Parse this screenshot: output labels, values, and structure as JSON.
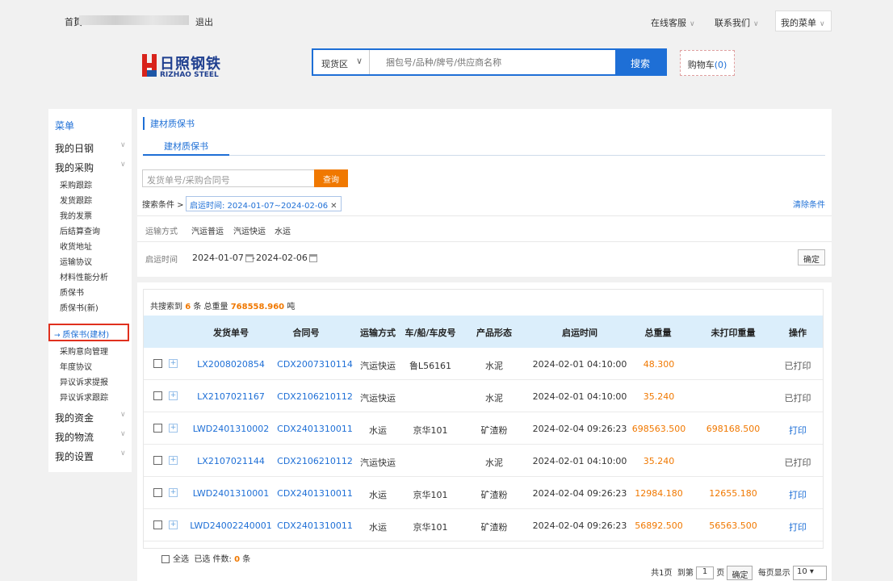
{
  "topbar": {
    "home": "首页",
    "separator": "|",
    "logout": "退出",
    "online_service": "在线客服",
    "contact_us": "联系我们",
    "my_menu": "我的菜单",
    "chevron": "∨"
  },
  "header": {
    "logo_cn": "日照钢铁",
    "logo_en": "RIZHAO STEEL",
    "search_scope": "现货区",
    "search_placeholder": "捆包号/品种/牌号/供应商名称",
    "search_button": "搜索",
    "cart_label": "购物车",
    "cart_count": "(0)"
  },
  "sidebar": {
    "title": "菜单",
    "groups": [
      {
        "label": "我的日钢"
      },
      {
        "label": "我的采购"
      },
      {
        "label": "我的资金"
      },
      {
        "label": "我的物流"
      },
      {
        "label": "我的设置"
      }
    ],
    "items": [
      {
        "label": "采购跟踪"
      },
      {
        "label": "发货跟踪"
      },
      {
        "label": "我的发票"
      },
      {
        "label": "后结算查询"
      },
      {
        "label": "收货地址"
      },
      {
        "label": "运输协议"
      },
      {
        "label": "材料性能分析"
      },
      {
        "label": "质保书"
      },
      {
        "label": "质保书(新)"
      },
      {
        "label": "质保书(建材)"
      },
      {
        "label": "采购意向管理"
      },
      {
        "label": "年度协议"
      },
      {
        "label": "异议诉求提报"
      },
      {
        "label": "异议诉求跟踪"
      }
    ]
  },
  "filter": {
    "page_title": "建材质保书",
    "tab": "建材质保书",
    "input_placeholder": "发货单号/采购合同号",
    "query_button": "查询",
    "conditions_label": "搜索条件 >",
    "condition_chip": "启运时间: 2024-01-07~2024-02-06",
    "chip_close": "✕",
    "clear": "清除条件",
    "transport_label": "运输方式",
    "transport_options": [
      "汽运普运",
      "汽运快运",
      "水运"
    ],
    "date_label": "启运时间",
    "date_from": "2024-01-07",
    "date_sep": "-",
    "date_to": "2024-02-06",
    "confirm": "确定"
  },
  "results": {
    "summary_prefix": "共搜索到",
    "count": "6",
    "summary_mid": "条 总重量",
    "total_weight": "768558.960",
    "summary_unit": "吨",
    "columns": [
      "发货单号",
      "合同号",
      "运输方式",
      "车/船/车皮号",
      "产品形态",
      "启运时间",
      "总重量",
      "未打印重量",
      "操作"
    ],
    "rows": [
      {
        "ship_no": "LX2008020854",
        "contract": "CDX2007310114",
        "transport": "汽运快运",
        "vehicle": "鲁L56161",
        "form": "水泥",
        "time": "2024-02-01 04:10:00",
        "weight": "48.300",
        "unprinted": "",
        "action": "已打印"
      },
      {
        "ship_no": "LX2107021167",
        "contract": "CDX2106210112",
        "transport": "汽运快运",
        "vehicle": "",
        "form": "水泥",
        "time": "2024-02-01 04:10:00",
        "weight": "35.240",
        "unprinted": "",
        "action": "已打印"
      },
      {
        "ship_no": "LWD2401310002",
        "contract": "CDX2401310011",
        "transport": "水运",
        "vehicle": "京华101",
        "form": "矿渣粉",
        "time": "2024-02-04 09:26:23",
        "weight": "698563.500",
        "unprinted": "698168.500",
        "action": "打印"
      },
      {
        "ship_no": "LX2107021144",
        "contract": "CDX2106210112",
        "transport": "汽运快运",
        "vehicle": "",
        "form": "水泥",
        "time": "2024-02-01 04:10:00",
        "weight": "35.240",
        "unprinted": "",
        "action": "已打印"
      },
      {
        "ship_no": "LWD2401310001",
        "contract": "CDX2401310011",
        "transport": "水运",
        "vehicle": "京华101",
        "form": "矿渣粉",
        "time": "2024-02-04 09:26:23",
        "weight": "12984.180",
        "unprinted": "12655.180",
        "action": "打印"
      },
      {
        "ship_no": "LWD24002240001",
        "contract": "CDX2401310011",
        "transport": "水运",
        "vehicle": "京华101",
        "form": "矿渣粉",
        "time": "2024-02-04 09:26:23",
        "weight": "56892.500",
        "unprinted": "56563.500",
        "action": "打印"
      }
    ],
    "select_all": "全选",
    "selected_label": "已选 件数:",
    "selected_count": "0",
    "selected_unit": "条",
    "pager": {
      "total_pages": "共1页",
      "goto_prefix": "到第",
      "page_value": "1",
      "goto_suffix": "页",
      "confirm": "确定",
      "per_page_label": "每页显示",
      "per_page": "10 ▾"
    }
  },
  "colors": {
    "accent": "#1e6fd6",
    "orange": "#f07800",
    "header_row": "#dbeefb",
    "highlight_border": "#e0301e"
  },
  "icons": [
    "chevron-down-icon",
    "calendar-icon",
    "expand-icon",
    "checkbox-icon",
    "close-icon",
    "arrow-right-icon"
  ]
}
